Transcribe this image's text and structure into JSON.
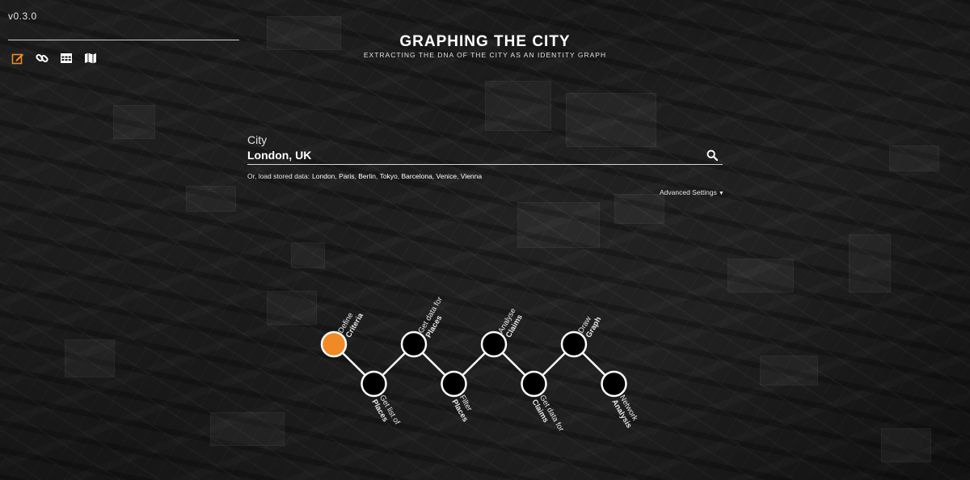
{
  "app": {
    "version": "v0.3.0",
    "title": "GRAPHING THE CITY",
    "subtitle": "EXTRACTING THE DNA OF THE CITY AS AN IDENTITY GRAPH"
  },
  "toolbar": {
    "items": [
      {
        "name": "edit-icon",
        "active": true
      },
      {
        "name": "link-icon",
        "active": false
      },
      {
        "name": "table-icon",
        "active": false
      },
      {
        "name": "map-icon",
        "active": false
      }
    ]
  },
  "colors": {
    "accent": "#f08a24",
    "node_fill": "#000000",
    "node_stroke": "#ffffff",
    "text": "#ffffff"
  },
  "search": {
    "label": "City",
    "value": "London, UK",
    "icon": "search-icon",
    "stored_prefix": "Or, load stored data:",
    "stored_cities": [
      "London",
      "Paris",
      "Berlin",
      "Tokyo",
      "Barcelona",
      "Venice",
      "Vienna"
    ],
    "advanced_label": "Advanced Settings",
    "advanced_icon": "caret-down-icon"
  },
  "steps": [
    {
      "line1": "Define",
      "line2": "Criteria",
      "active": true
    },
    {
      "line1": "Get list of",
      "line2": "Places",
      "active": false
    },
    {
      "line1": "Get data for",
      "line2": "Places",
      "active": false
    },
    {
      "line1": "Filter",
      "line2": "Places",
      "active": false
    },
    {
      "line1": "Analyse",
      "line2": "Claims",
      "active": false
    },
    {
      "line1": "Get data for",
      "line2": "Claims",
      "active": false
    },
    {
      "line1": "Draw",
      "line2": "Graph",
      "active": false
    },
    {
      "line1": "Network",
      "line2": "Analysis",
      "active": false
    }
  ]
}
